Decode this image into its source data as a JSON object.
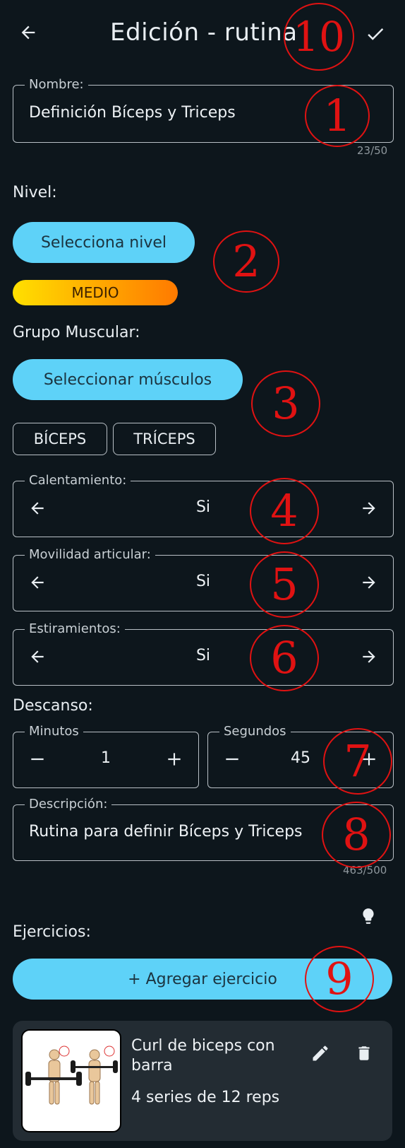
{
  "header": {
    "title": "Edición - rutina",
    "back_icon": "arrow-left-icon",
    "confirm_icon": "check-icon"
  },
  "name_field": {
    "label": "Nombre:",
    "value": "Definición Bíceps y Triceps",
    "counter": "23/50"
  },
  "level": {
    "section_label": "Nivel:",
    "button_label": "Selecciona nivel",
    "selected": "MEDIO"
  },
  "muscle_group": {
    "section_label": "Grupo Muscular:",
    "button_label": "Seleccionar músculos",
    "chips": [
      "BÍCEPS",
      "TRÍCEPS"
    ]
  },
  "toggles": [
    {
      "label": "Calentamiento:",
      "value": "Si"
    },
    {
      "label": "Movilidad articular:",
      "value": "Si"
    },
    {
      "label": "Estiramientos:",
      "value": "Si"
    }
  ],
  "rest": {
    "section_label": "Descanso:",
    "minutes": {
      "label": "Minutos",
      "value": "1"
    },
    "seconds": {
      "label": "Segundos",
      "value": "45"
    }
  },
  "description": {
    "label": "Descripción:",
    "value": "Rutina para definir Bíceps y Triceps",
    "counter": "463/500"
  },
  "exercises": {
    "section_label": "Ejercicios:",
    "hint_icon": "lightbulb-icon",
    "add_button": "+ Agregar ejercicio",
    "items": [
      {
        "name": "Curl de biceps con barra",
        "detail": "4 series de 12 reps"
      }
    ]
  },
  "annotations": [
    "1",
    "2",
    "3",
    "4",
    "5",
    "6",
    "7",
    "8",
    "9",
    "10"
  ],
  "colors": {
    "background": "#0d161c",
    "accent": "#5ed2f8",
    "annotation_red": "#e01212",
    "card": "#232c33"
  }
}
